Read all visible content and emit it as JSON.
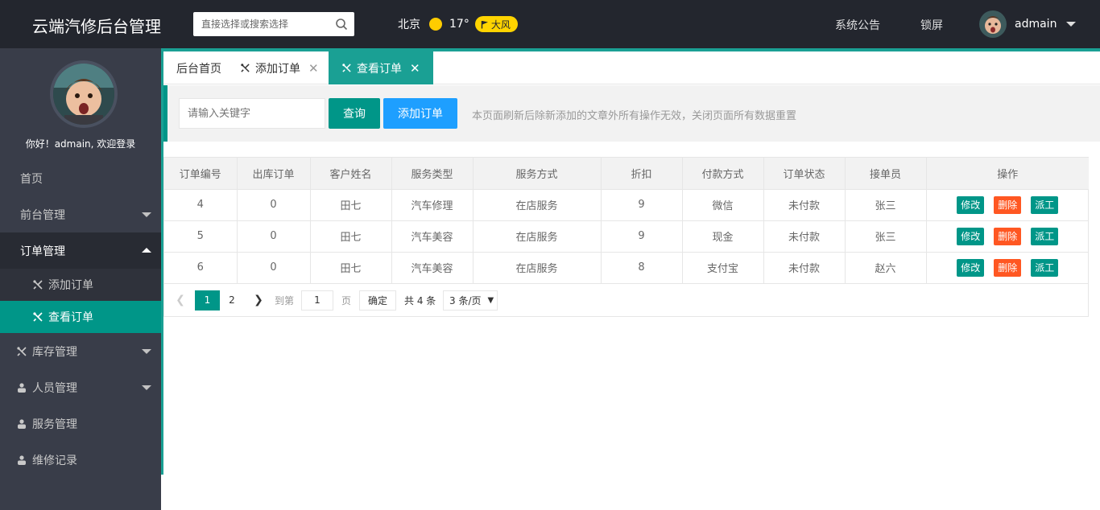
{
  "header": {
    "title": "云端汽修后台管理",
    "search_placeholder": "直接选择或搜索选择",
    "city": "北京",
    "temperature": "17°",
    "wind": "大风",
    "notice": "系统公告",
    "lock": "锁屏",
    "username": "admain"
  },
  "sidebar": {
    "welcome": "你好！admain, 欢迎登录",
    "items": [
      {
        "label": "首页"
      },
      {
        "label": "前台管理"
      },
      {
        "label": "订单管理"
      },
      {
        "label": "添加订单"
      },
      {
        "label": "查看订单"
      },
      {
        "label": "库存管理"
      },
      {
        "label": "人员管理"
      },
      {
        "label": "服务管理"
      },
      {
        "label": "维修记录"
      }
    ]
  },
  "tabs": [
    {
      "label": "后台首页"
    },
    {
      "label": "添加订单"
    },
    {
      "label": "查看订单"
    }
  ],
  "toolbar": {
    "keyword_placeholder": "请输入关键字",
    "query_label": "查询",
    "add_label": "添加订单",
    "tip": "本页面刷新后除新添加的文章外所有操作无效，关闭页面所有数据重置"
  },
  "table": {
    "columns": [
      "订单编号",
      "出库订单",
      "客户姓名",
      "服务类型",
      "服务方式",
      "折扣",
      "付款方式",
      "订单状态",
      "接单员",
      "操作"
    ],
    "rows": [
      [
        "4",
        "0",
        "田七",
        "汽车修理",
        "在店服务",
        "9",
        "微信",
        "未付款",
        "张三"
      ],
      [
        "5",
        "0",
        "田七",
        "汽车美容",
        "在店服务",
        "9",
        "现金",
        "未付款",
        "张三"
      ],
      [
        "6",
        "0",
        "田七",
        "汽车美容",
        "在店服务",
        "8",
        "支付宝",
        "未付款",
        "赵六"
      ]
    ],
    "actions": {
      "edit": "修改",
      "delete": "删除",
      "dispatch": "派工"
    }
  },
  "pager": {
    "current": "1",
    "page2": "2",
    "goto": "到第",
    "goto_value": "1",
    "page_unit": "页",
    "confirm": "确定",
    "total": "共 4 条",
    "per_page": "3 条/页"
  },
  "colors": {
    "header_bg": "#23262e",
    "sidebar_bg": "#393d49",
    "accent": "#009688",
    "blue": "#1e9fff",
    "danger": "#ff5722"
  }
}
